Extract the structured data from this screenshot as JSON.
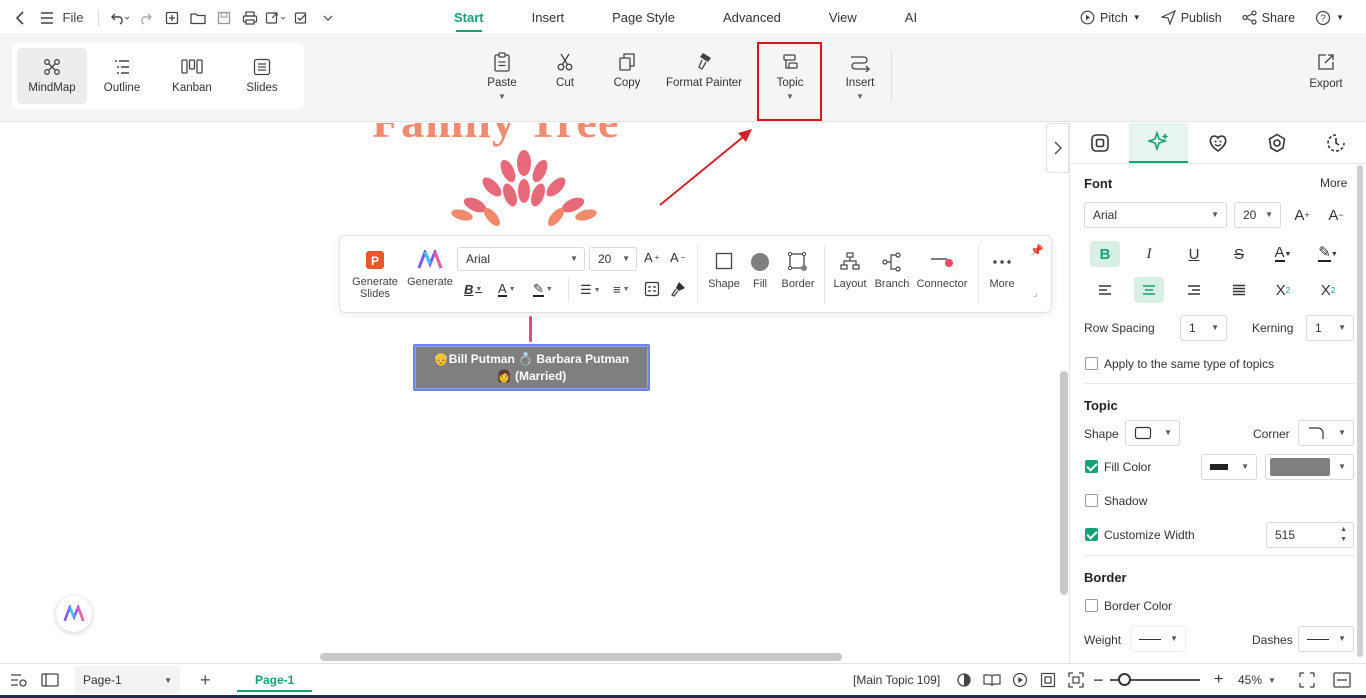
{
  "menubar": {
    "file_label": "File",
    "tabs": [
      {
        "label": "Start",
        "active": true
      },
      {
        "label": "Insert"
      },
      {
        "label": "Page Style"
      },
      {
        "label": "Advanced"
      },
      {
        "label": "View"
      },
      {
        "label": "AI"
      }
    ],
    "pitch": "Pitch",
    "publish": "Publish",
    "share": "Share"
  },
  "views": [
    {
      "label": "MindMap",
      "active": true
    },
    {
      "label": "Outline"
    },
    {
      "label": "Kanban"
    },
    {
      "label": "Slides"
    }
  ],
  "ribbon": {
    "paste": "Paste",
    "cut": "Cut",
    "copy": "Copy",
    "format_painter": "Format Painter",
    "topic": "Topic",
    "insert": "Insert",
    "export": "Export"
  },
  "canvas": {
    "title_partial": "Family Tree",
    "topic_line1": "👴Bill Putman 💍 Barbara Putman",
    "topic_line2": "👩 (Married)"
  },
  "floating_toolbar": {
    "generate_slides": "Generate Slides",
    "generate": "Generate",
    "font": "Arial",
    "size": "20",
    "shape": "Shape",
    "fill": "Fill",
    "border": "Border",
    "layout": "Layout",
    "branch": "Branch",
    "connector": "Connector",
    "more": "More"
  },
  "panel": {
    "font_title": "Font",
    "more": "More",
    "font_family": "Arial",
    "font_size": "20",
    "row_spacing_label": "Row Spacing",
    "row_spacing_value": "1",
    "kerning_label": "Kerning",
    "kerning_value": "1",
    "apply_same": "Apply to the same type of topics",
    "topic_title": "Topic",
    "shape_label": "Shape",
    "corner_label": "Corner",
    "fill_color_label": "Fill Color",
    "fill_color": "#808080",
    "shadow_label": "Shadow",
    "custom_width_label": "Customize Width",
    "custom_width_value": "515",
    "border_title": "Border",
    "border_color_label": "Border Color",
    "weight_label": "Weight",
    "dashes_label": "Dashes"
  },
  "statusbar": {
    "page_select": "Page-1",
    "page_tab": "Page-1",
    "selection_info": "[Main Topic 109]",
    "zoom": "45%"
  },
  "colors": {
    "accent": "#12a178",
    "highlight_box": "#d9141b",
    "arrow": "#d1232a",
    "topic_fill": "#808080",
    "topic_border": "#6f82f3"
  }
}
